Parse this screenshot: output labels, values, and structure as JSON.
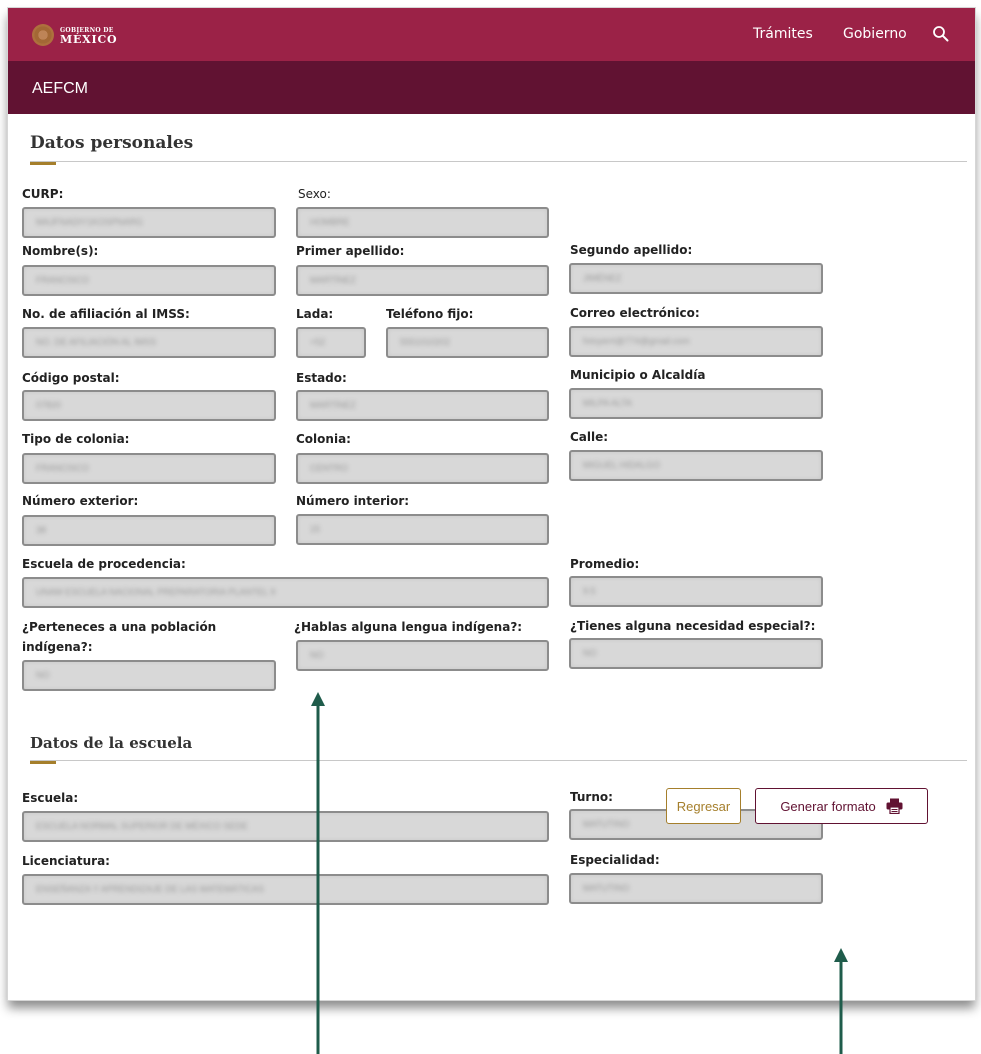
{
  "header": {
    "logo_line1": "GOBIERNO DE",
    "logo_line2": "MÉXICO",
    "nav": [
      "Trámites",
      "Gobierno"
    ],
    "search_icon": "search-icon"
  },
  "subheader": {
    "title": "AEFCM"
  },
  "sections": {
    "personal": "Datos personales",
    "school": "Datos de la escuela"
  },
  "fields": {
    "curp": {
      "label": "CURP:",
      "value": "MAJFNADIY1KOSPNARG"
    },
    "sexo": {
      "label": "Sexo:",
      "value": "HOMBRE"
    },
    "nombre": {
      "label": "Nombre(s):",
      "value": "FRANCISCO"
    },
    "primer_apellido": {
      "label": "Primer apellido:",
      "value": "MARTÍNEZ"
    },
    "segundo_apellido": {
      "label": "Segundo apellido:",
      "value": "JIMÉNEZ"
    },
    "imss": {
      "label": "No. de afiliación al IMSS:",
      "value": "NO. DE AFILIACIÓN AL IMSS"
    },
    "lada": {
      "label": "Lada:",
      "value": "+52"
    },
    "telefono": {
      "label": "Teléfono fijo:",
      "value": "5551010202"
    },
    "correo": {
      "label": "Correo electrónico:",
      "value": "fvtoyerrt@774@gmail.com"
    },
    "cp": {
      "label": "Código postal:",
      "value": "07820"
    },
    "estado": {
      "label": "Estado:",
      "value": "MARTÍNEZ"
    },
    "municipio": {
      "label": "Municipio o Alcaldía",
      "value": "MILPA ALTA"
    },
    "tipo_colonia": {
      "label": "Tipo de colonia:",
      "value": "FRANCISCO"
    },
    "colonia": {
      "label": "Colonia:",
      "value": "CENTRO"
    },
    "calle": {
      "label": "Calle:",
      "value": "MIGUEL HIDALGO"
    },
    "num_ext": {
      "label": "Número exterior:",
      "value": "38"
    },
    "num_int": {
      "label": "Número interior:",
      "value": "15"
    },
    "escuela_procedencia": {
      "label": "Escuela de procedencia:",
      "value": "UNAM ESCUELA NACIONAL PREPARATORIA PLANTEL 9"
    },
    "promedio": {
      "label": "Promedio:",
      "value": "9.5"
    },
    "indigena": {
      "label_line1": "¿Perteneces a una población",
      "label_line2": "indígena?:",
      "value": "NO"
    },
    "lengua": {
      "label": "¿Hablas alguna lengua indígena?:",
      "value": "NO"
    },
    "necesidad": {
      "label": "¿Tienes alguna necesidad especial?:",
      "value": "NO"
    },
    "escuela": {
      "label": "Escuela:",
      "value": "ESCUELA NORMAL SUPERIOR DE MÉXICO SEDE"
    },
    "turno": {
      "label": "Turno:",
      "value": "MATUTINO"
    },
    "licenciatura": {
      "label": "Licenciatura:",
      "value": "ENSEÑANZA Y APRENDIZAJE DE LAS MATEMÁTICAS"
    },
    "especialidad": {
      "label": "Especialidad:",
      "value": "MATUTINO"
    }
  },
  "buttons": {
    "regresar": "Regresar",
    "generar": "Generar formato",
    "generar_icon": "printer-icon"
  },
  "colors": {
    "primary": "#9b2247",
    "secondary": "#611232",
    "accent": "#a57f2c",
    "arrow": "#1f5c4b"
  }
}
